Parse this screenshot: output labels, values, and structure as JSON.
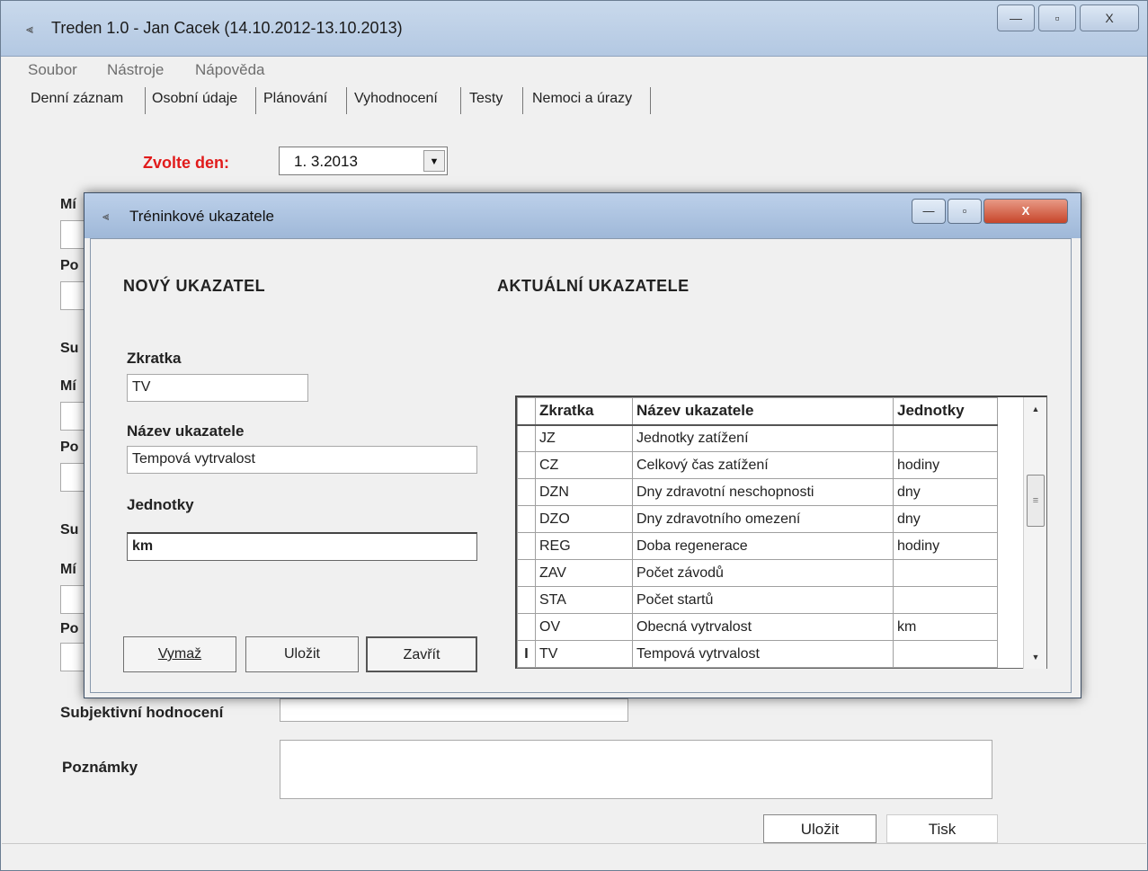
{
  "window": {
    "title": "Treden 1.0 - Jan Cacek (14.10.2012-13.10.2013)",
    "minimize": "—",
    "maximize": "▫",
    "close": "X"
  },
  "menu": [
    "Soubor",
    "Nástroje",
    "Nápověda"
  ],
  "tabs": [
    "Denní záznam",
    "Osobní údaje",
    "Plánování",
    "Vyhodnocení",
    "Testy",
    "Nemoci a úrazy"
  ],
  "main": {
    "choose_day_label": "Zvolte den:",
    "date_value": "1. 3.2013",
    "side_labels": [
      "Mí",
      "Po",
      "Su",
      "Mí",
      "Po",
      "Su",
      "Mí",
      "Po"
    ],
    "subjective_label": "Subjektivní hodnocení",
    "notes_label": "Poznámky",
    "save_button": "Uložit",
    "print_button": "Tisk"
  },
  "dialog": {
    "title": "Tréninkové ukazatele",
    "new_header": "NOVÝ UKAZATEL",
    "current_header": "AKTUÁLNÍ UKAZATELE",
    "abbr_label": "Zkratka",
    "abbr_value": "TV",
    "name_label": "Název ukazatele",
    "name_value": "Tempová vytrvalost",
    "units_label": "Jednotky",
    "units_value": "km",
    "delete_button": "Vymaž",
    "save_button": "Uložit",
    "close_button": "Zavřít",
    "columns": [
      "Zkratka",
      "Název ukazatele",
      "Jednotky"
    ],
    "rows": [
      {
        "abbr": "JZ",
        "name": "Jednotky zatížení",
        "unit": ""
      },
      {
        "abbr": "CZ",
        "name": "Celkový čas zatížení",
        "unit": "hodiny"
      },
      {
        "abbr": "DZN",
        "name": "Dny zdravotní neschopnosti",
        "unit": "dny"
      },
      {
        "abbr": "DZO",
        "name": "Dny zdravotního omezení",
        "unit": "dny"
      },
      {
        "abbr": "REG",
        "name": "Doba regenerace",
        "unit": "hodiny"
      },
      {
        "abbr": "ZAV",
        "name": "Počet závodů",
        "unit": ""
      },
      {
        "abbr": "STA",
        "name": "Počet startů",
        "unit": ""
      },
      {
        "abbr": "OV",
        "name": "Obecná vytrvalost",
        "unit": "km"
      },
      {
        "abbr": "TV",
        "name": "Tempová vytrvalost",
        "unit": ""
      }
    ]
  }
}
